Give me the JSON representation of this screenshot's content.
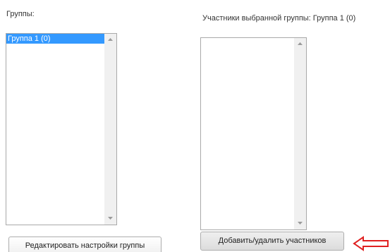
{
  "groups_panel": {
    "label": "Группы:",
    "items": [
      {
        "label": "Группа 1 (0)",
        "selected": true
      }
    ]
  },
  "members_panel": {
    "label": "Участники выбранной группы: Группа 1 (0)",
    "items": []
  },
  "buttons": {
    "edit_group_settings": "Редактировать настройки группы",
    "add_remove_members": "Добавить/удалить участников"
  },
  "colors": {
    "selection": "#3399ff",
    "annotation_arrow": "#e02020"
  },
  "icons": {
    "scroll_up": "scroll-up-arrow-icon",
    "scroll_down": "scroll-down-arrow-icon",
    "annotation": "left-arrow-icon"
  }
}
